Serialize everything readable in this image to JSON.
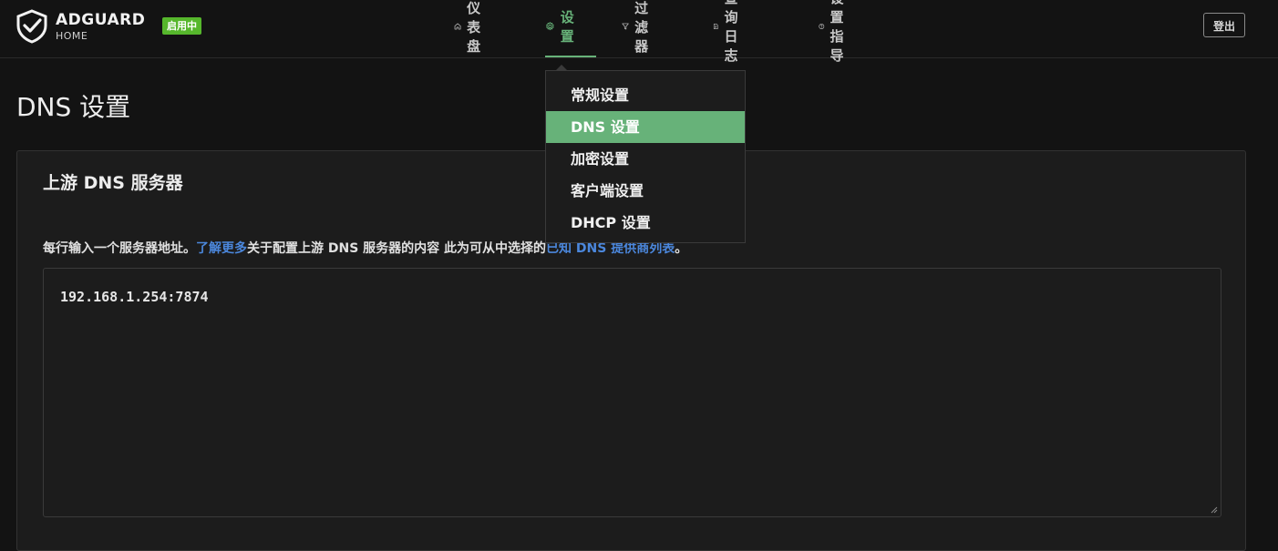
{
  "header": {
    "logo_name": "ADGUARD",
    "logo_sub": "HOME",
    "status_badge": "启用中",
    "logout_label": "登出"
  },
  "nav": {
    "dashboard": "仪表盘",
    "settings": "设置",
    "filters": "过滤器",
    "query_log": "查询日志",
    "setup_guide": "设置指导"
  },
  "dropdown": {
    "items": [
      "常规设置",
      "DNS 设置",
      "加密设置",
      "客户端设置",
      "DHCP 设置"
    ],
    "active_index": 1
  },
  "page": {
    "title": "DNS 设置"
  },
  "upstream": {
    "title": "上游 DNS 服务器",
    "desc_prefix": "每行输入一个服务器地址。",
    "desc_link1": "了解更多",
    "desc_middle": "关于配置上游 DNS 服务器的内容 此为可从中选择的",
    "desc_link2": "已知 DNS 提供商列表",
    "desc_suffix": "。",
    "value": "192.168.1.254:7874"
  },
  "colors": {
    "accent": "#67b279",
    "badge": "#56b72c",
    "link": "#4b87dc"
  }
}
